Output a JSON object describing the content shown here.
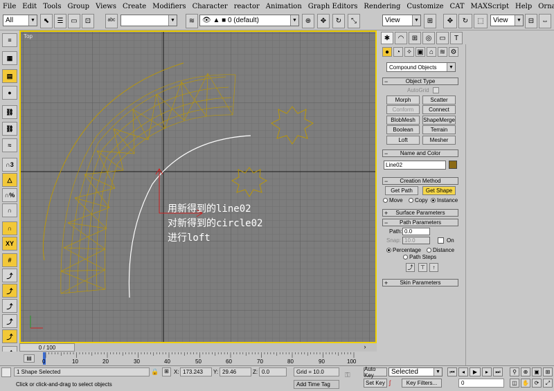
{
  "menu": [
    "File",
    "Edit",
    "Tools",
    "Group",
    "Views",
    "Create",
    "Modifiers",
    "Character",
    "reactor",
    "Animation",
    "Graph Editors",
    "Rendering",
    "Customize",
    "CAT",
    "MAXScript",
    "Help",
    "Ornatrix"
  ],
  "toolbar": {
    "selection_filter": "All",
    "named_selection": "",
    "layer": "0 (default)",
    "ref_coord_1": "View",
    "ref_coord_2": "View"
  },
  "viewport": {
    "label": "Top",
    "overlay_lines": [
      "用新得到的line02",
      "对新得到的circle02",
      "进行loft"
    ]
  },
  "command_panel": {
    "category_dropdown": "Compound Objects",
    "object_type": {
      "title": "Object Type",
      "autogrid_label": "AutoGrid",
      "buttons": [
        "Morph",
        "Scatter",
        "Conform",
        "Connect",
        "BlobMesh",
        "ShapeMerge",
        "Boolean",
        "Terrain",
        "Loft",
        "Mesher"
      ]
    },
    "name_color": {
      "title": "Name and Color",
      "name_value": "Line02",
      "color": "#8b6a14"
    },
    "creation_method": {
      "title": "Creation Method",
      "get_path": "Get Path",
      "get_shape": "Get Shape",
      "radio": [
        "Move",
        "Copy",
        "Instance"
      ]
    },
    "surface_params": {
      "title": "Surface Parameters"
    },
    "path_params": {
      "title": "Path Parameters",
      "path_label": "Path:",
      "path_value": "0.0",
      "snap_label": "Snap:",
      "snap_value": "10.0",
      "on_label": "On",
      "percentage": "Percentage",
      "distance": "Distance",
      "path_steps": "Path Steps"
    },
    "skin_params": {
      "title": "Skin Parameters"
    }
  },
  "timeline": {
    "frame": "0 / 100",
    "ticks": [
      "0",
      "10",
      "20",
      "30",
      "40",
      "50",
      "60",
      "70",
      "80",
      "90",
      "100"
    ]
  },
  "status": {
    "selection": "1 Shape Selected",
    "prompt": "Click or click-and-drag to select objects",
    "x_label": "X:",
    "x_value": "173.243",
    "y_label": "Y:",
    "y_value": "29.46",
    "z_label": "Z:",
    "z_value": "0.0",
    "grid": "Grid = 10.0",
    "add_time_tag": "Add Time Tag",
    "auto_key": "Auto Key",
    "set_key": "Set Key",
    "key_mode": "Selected",
    "key_filters": "Key Filters...",
    "frame_field": "0"
  },
  "colors": {
    "accent": "#f0d000",
    "wire": "#b8960a",
    "viewport_bg": "#7d7d7d",
    "grid": "#6a6a6a"
  }
}
